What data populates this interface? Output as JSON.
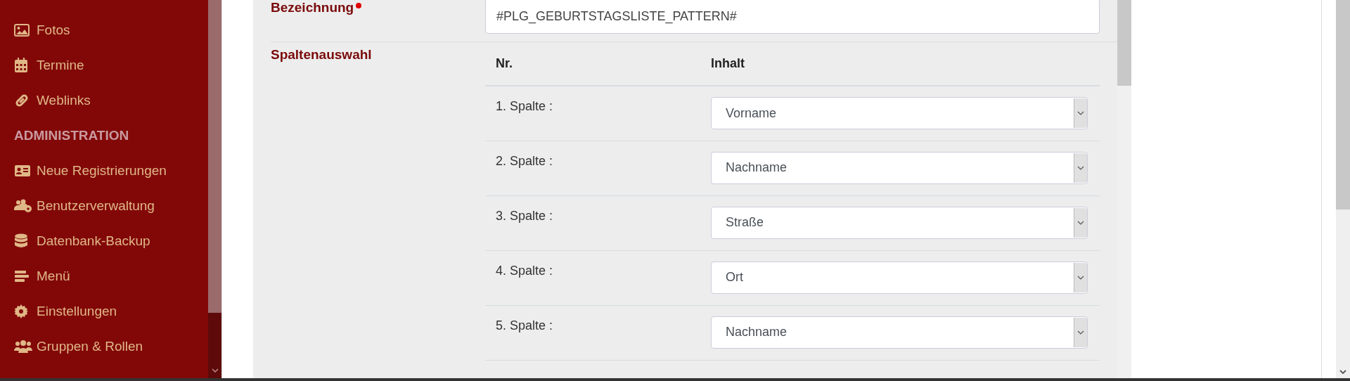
{
  "sidebar": {
    "items": [
      {
        "kind": "link",
        "label": "Fotos"
      },
      {
        "kind": "link",
        "label": "Termine"
      },
      {
        "kind": "link",
        "label": "Weblinks"
      },
      {
        "kind": "heading",
        "label": "ADMINISTRATION"
      },
      {
        "kind": "link",
        "label": "Neue Registrierungen"
      },
      {
        "kind": "link",
        "label": "Benutzerverwaltung"
      },
      {
        "kind": "link",
        "label": "Datenbank-Backup"
      },
      {
        "kind": "link",
        "label": "Menü"
      },
      {
        "kind": "link",
        "label": "Einstellungen"
      },
      {
        "kind": "link",
        "label": "Gruppen & Rollen"
      }
    ]
  },
  "form": {
    "name_field": {
      "label": "Bezeichnung",
      "required": true,
      "value": "#PLG_GEBURTSTAGSLISTE_PATTERN#"
    },
    "column_selection": {
      "label": "Spaltenauswahl",
      "columns": [
        "Nr.",
        "Inhalt"
      ],
      "rows": [
        {
          "number": "1. Spalte :",
          "content": "Vorname"
        },
        {
          "number": "2. Spalte :",
          "content": "Nachname"
        },
        {
          "number": "3. Spalte :",
          "content": "Straße"
        },
        {
          "number": "4. Spalte :",
          "content": "Ort"
        },
        {
          "number": "5. Spalte :",
          "content": "Nachname"
        }
      ]
    }
  }
}
